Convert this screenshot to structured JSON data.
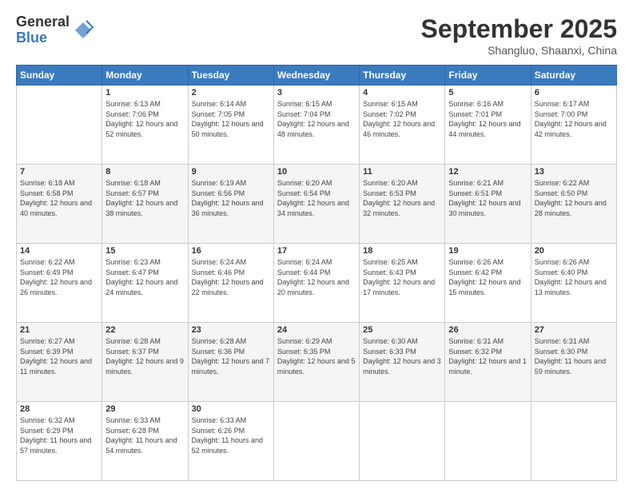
{
  "logo": {
    "general": "General",
    "blue": "Blue"
  },
  "title": {
    "month": "September 2025",
    "location": "Shangluo, Shaanxi, China"
  },
  "weekdays": [
    "Sunday",
    "Monday",
    "Tuesday",
    "Wednesday",
    "Thursday",
    "Friday",
    "Saturday"
  ],
  "weeks": [
    [
      {
        "day": "",
        "sunrise": "",
        "sunset": "",
        "daylight": ""
      },
      {
        "day": "1",
        "sunrise": "Sunrise: 6:13 AM",
        "sunset": "Sunset: 7:06 PM",
        "daylight": "Daylight: 12 hours and 52 minutes."
      },
      {
        "day": "2",
        "sunrise": "Sunrise: 6:14 AM",
        "sunset": "Sunset: 7:05 PM",
        "daylight": "Daylight: 12 hours and 50 minutes."
      },
      {
        "day": "3",
        "sunrise": "Sunrise: 6:15 AM",
        "sunset": "Sunset: 7:04 PM",
        "daylight": "Daylight: 12 hours and 48 minutes."
      },
      {
        "day": "4",
        "sunrise": "Sunrise: 6:15 AM",
        "sunset": "Sunset: 7:02 PM",
        "daylight": "Daylight: 12 hours and 46 minutes."
      },
      {
        "day": "5",
        "sunrise": "Sunrise: 6:16 AM",
        "sunset": "Sunset: 7:01 PM",
        "daylight": "Daylight: 12 hours and 44 minutes."
      },
      {
        "day": "6",
        "sunrise": "Sunrise: 6:17 AM",
        "sunset": "Sunset: 7:00 PM",
        "daylight": "Daylight: 12 hours and 42 minutes."
      }
    ],
    [
      {
        "day": "7",
        "sunrise": "Sunrise: 6:18 AM",
        "sunset": "Sunset: 6:58 PM",
        "daylight": "Daylight: 12 hours and 40 minutes."
      },
      {
        "day": "8",
        "sunrise": "Sunrise: 6:18 AM",
        "sunset": "Sunset: 6:57 PM",
        "daylight": "Daylight: 12 hours and 38 minutes."
      },
      {
        "day": "9",
        "sunrise": "Sunrise: 6:19 AM",
        "sunset": "Sunset: 6:56 PM",
        "daylight": "Daylight: 12 hours and 36 minutes."
      },
      {
        "day": "10",
        "sunrise": "Sunrise: 6:20 AM",
        "sunset": "Sunset: 6:54 PM",
        "daylight": "Daylight: 12 hours and 34 minutes."
      },
      {
        "day": "11",
        "sunrise": "Sunrise: 6:20 AM",
        "sunset": "Sunset: 6:53 PM",
        "daylight": "Daylight: 12 hours and 32 minutes."
      },
      {
        "day": "12",
        "sunrise": "Sunrise: 6:21 AM",
        "sunset": "Sunset: 6:51 PM",
        "daylight": "Daylight: 12 hours and 30 minutes."
      },
      {
        "day": "13",
        "sunrise": "Sunrise: 6:22 AM",
        "sunset": "Sunset: 6:50 PM",
        "daylight": "Daylight: 12 hours and 28 minutes."
      }
    ],
    [
      {
        "day": "14",
        "sunrise": "Sunrise: 6:22 AM",
        "sunset": "Sunset: 6:49 PM",
        "daylight": "Daylight: 12 hours and 26 minutes."
      },
      {
        "day": "15",
        "sunrise": "Sunrise: 6:23 AM",
        "sunset": "Sunset: 6:47 PM",
        "daylight": "Daylight: 12 hours and 24 minutes."
      },
      {
        "day": "16",
        "sunrise": "Sunrise: 6:24 AM",
        "sunset": "Sunset: 6:46 PM",
        "daylight": "Daylight: 12 hours and 22 minutes."
      },
      {
        "day": "17",
        "sunrise": "Sunrise: 6:24 AM",
        "sunset": "Sunset: 6:44 PM",
        "daylight": "Daylight: 12 hours and 20 minutes."
      },
      {
        "day": "18",
        "sunrise": "Sunrise: 6:25 AM",
        "sunset": "Sunset: 6:43 PM",
        "daylight": "Daylight: 12 hours and 17 minutes."
      },
      {
        "day": "19",
        "sunrise": "Sunrise: 6:26 AM",
        "sunset": "Sunset: 6:42 PM",
        "daylight": "Daylight: 12 hours and 15 minutes."
      },
      {
        "day": "20",
        "sunrise": "Sunrise: 6:26 AM",
        "sunset": "Sunset: 6:40 PM",
        "daylight": "Daylight: 12 hours and 13 minutes."
      }
    ],
    [
      {
        "day": "21",
        "sunrise": "Sunrise: 6:27 AM",
        "sunset": "Sunset: 6:39 PM",
        "daylight": "Daylight: 12 hours and 11 minutes."
      },
      {
        "day": "22",
        "sunrise": "Sunrise: 6:28 AM",
        "sunset": "Sunset: 6:37 PM",
        "daylight": "Daylight: 12 hours and 9 minutes."
      },
      {
        "day": "23",
        "sunrise": "Sunrise: 6:28 AM",
        "sunset": "Sunset: 6:36 PM",
        "daylight": "Daylight: 12 hours and 7 minutes."
      },
      {
        "day": "24",
        "sunrise": "Sunrise: 6:29 AM",
        "sunset": "Sunset: 6:35 PM",
        "daylight": "Daylight: 12 hours and 5 minutes."
      },
      {
        "day": "25",
        "sunrise": "Sunrise: 6:30 AM",
        "sunset": "Sunset: 6:33 PM",
        "daylight": "Daylight: 12 hours and 3 minutes."
      },
      {
        "day": "26",
        "sunrise": "Sunrise: 6:31 AM",
        "sunset": "Sunset: 6:32 PM",
        "daylight": "Daylight: 12 hours and 1 minute."
      },
      {
        "day": "27",
        "sunrise": "Sunrise: 6:31 AM",
        "sunset": "Sunset: 6:30 PM",
        "daylight": "Daylight: 11 hours and 59 minutes."
      }
    ],
    [
      {
        "day": "28",
        "sunrise": "Sunrise: 6:32 AM",
        "sunset": "Sunset: 6:29 PM",
        "daylight": "Daylight: 11 hours and 57 minutes."
      },
      {
        "day": "29",
        "sunrise": "Sunrise: 6:33 AM",
        "sunset": "Sunset: 6:28 PM",
        "daylight": "Daylight: 11 hours and 54 minutes."
      },
      {
        "day": "30",
        "sunrise": "Sunrise: 6:33 AM",
        "sunset": "Sunset: 6:26 PM",
        "daylight": "Daylight: 11 hours and 52 minutes."
      },
      {
        "day": "",
        "sunrise": "",
        "sunset": "",
        "daylight": ""
      },
      {
        "day": "",
        "sunrise": "",
        "sunset": "",
        "daylight": ""
      },
      {
        "day": "",
        "sunrise": "",
        "sunset": "",
        "daylight": ""
      },
      {
        "day": "",
        "sunrise": "",
        "sunset": "",
        "daylight": ""
      }
    ]
  ]
}
